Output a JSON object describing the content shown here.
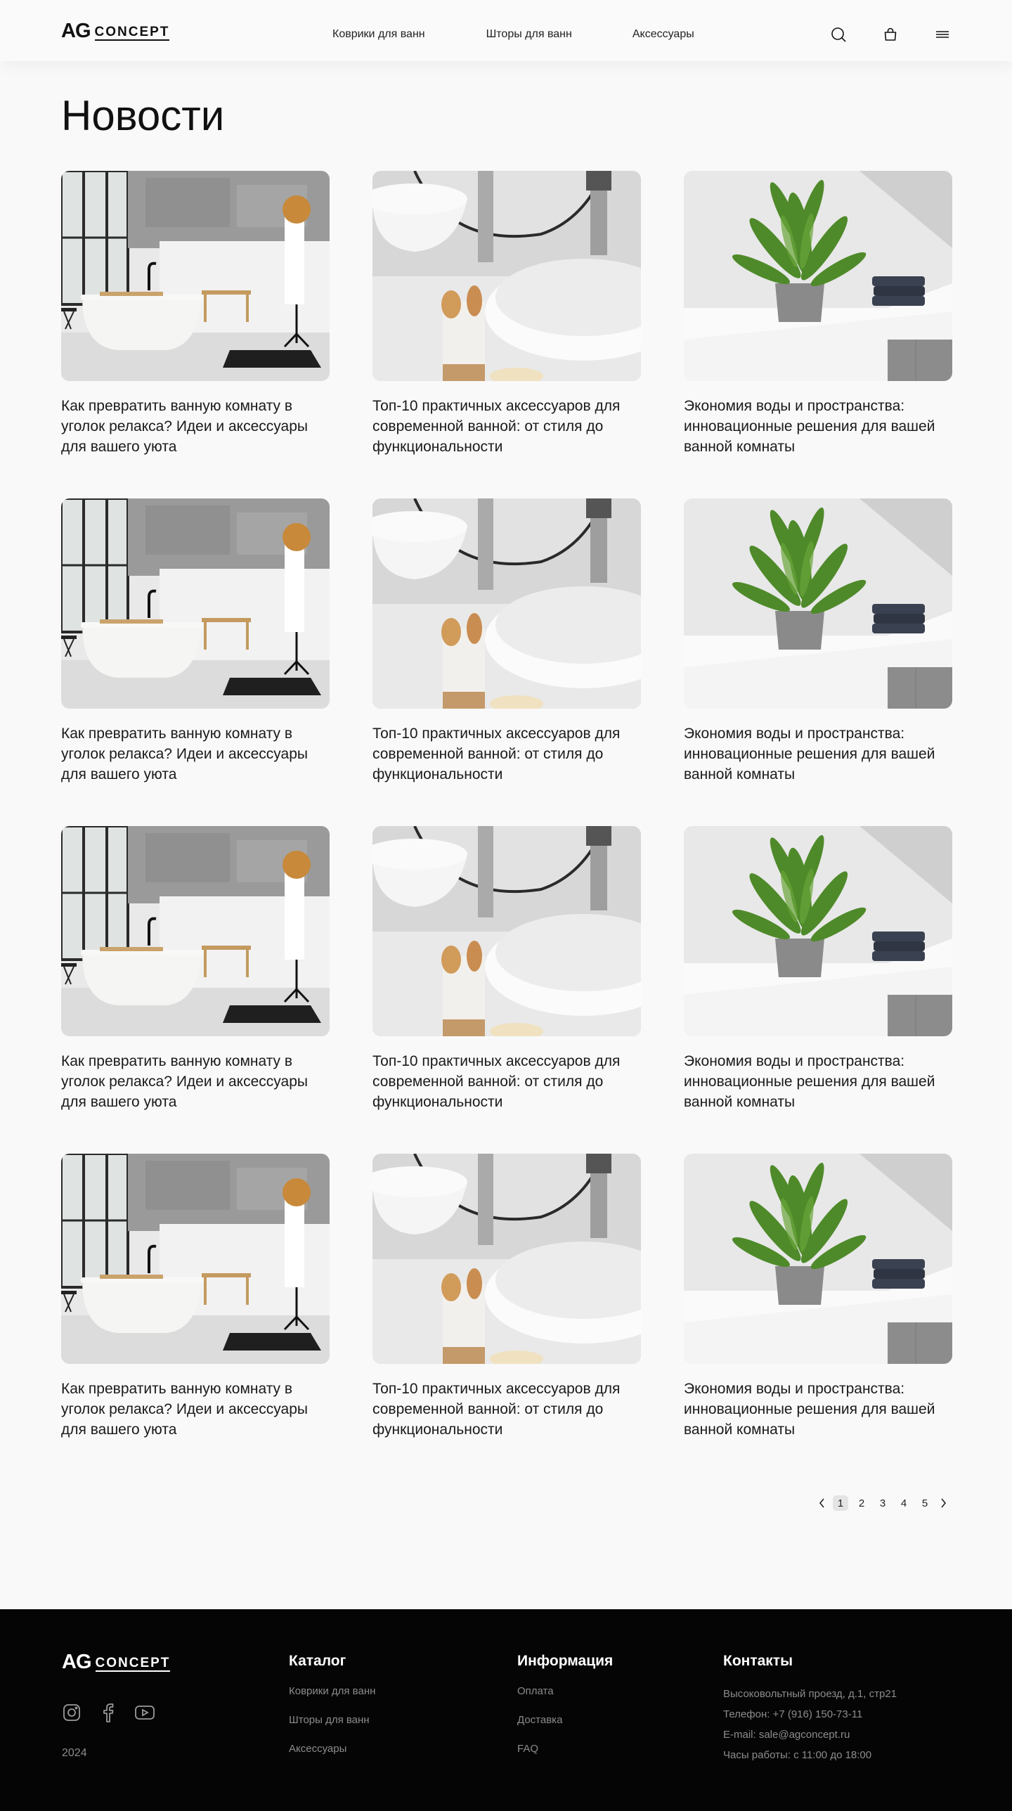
{
  "header": {
    "logo_ag": "AG",
    "logo_concept": "CONCEPT",
    "nav": [
      "Коврики для ванн",
      "Шторы для ванн",
      "Аксессуары"
    ],
    "icons": [
      "search-icon",
      "bag-icon",
      "menu-icon"
    ]
  },
  "page": {
    "title": "Новости"
  },
  "articles": [
    {
      "title": "Как превратить ванную комнату в уголок релакса? Идеи и аксессуары для вашего уюта",
      "image": "bathroom-bathtub"
    },
    {
      "title": "Топ-10 практичных аксессуаров для современной ванной: от стиля до функциональности",
      "image": "sink-accessories"
    },
    {
      "title": "Экономия воды и пространства: инновационные решения для вашей ванной комнаты",
      "image": "plant-bath"
    },
    {
      "title": "Как превратить ванную комнату в уголок релакса? Идеи и аксессуары для вашего уюта",
      "image": "bathroom-bathtub"
    },
    {
      "title": "Топ-10 практичных аксессуаров для современной ванной: от стиля до функциональности",
      "image": "sink-accessories"
    },
    {
      "title": "Экономия воды и пространства: инновационные решения для вашей ванной комнаты",
      "image": "plant-bath"
    },
    {
      "title": "Как превратить ванную комнату в уголок релакса? Идеи и аксессуары для вашего уюта",
      "image": "bathroom-bathtub"
    },
    {
      "title": "Топ-10 практичных аксессуаров для современной ванной: от стиля до функциональности",
      "image": "sink-accessories"
    },
    {
      "title": "Экономия воды и пространства: инновационные решения для вашей ванной комнаты",
      "image": "plant-bath"
    },
    {
      "title": "Как превратить ванную комнату в уголок релакса? Идеи и аксессуары для вашего уюта",
      "image": "bathroom-bathtub"
    },
    {
      "title": "Топ-10 практичных аксессуаров для современной ванной: от стиля до функциональности",
      "image": "sink-accessories"
    },
    {
      "title": "Экономия воды и пространства: инновационные решения для вашей ванной комнаты",
      "image": "plant-bath"
    }
  ],
  "pagination": {
    "pages": [
      "1",
      "2",
      "3",
      "4",
      "5"
    ],
    "current": "1"
  },
  "footer": {
    "logo_ag": "AG",
    "logo_concept": "CONCEPT",
    "social": [
      "instagram-icon",
      "facebook-icon",
      "youtube-icon"
    ],
    "year": "2024",
    "catalog": {
      "heading": "Каталог",
      "links": [
        "Коврики для ванн",
        "Шторы для ванн",
        "Аксессуары"
      ]
    },
    "info": {
      "heading": "Информация",
      "links": [
        "Оплата",
        "Доставка",
        "FAQ"
      ]
    },
    "contacts": {
      "heading": "Контакты",
      "address": "Высоковольтный проезд, д.1,  стр21",
      "phone": "Телефон: +7 (916) 150-73-11",
      "email": "E-mail: sale@agconcept.ru",
      "hours": "Часы работы:  с 11:00 до 18:00"
    }
  },
  "colors": {
    "background": "#f9f9f9",
    "text": "#1a1a1a",
    "footer_bg": "#050505",
    "footer_muted": "#8c8c8c"
  }
}
